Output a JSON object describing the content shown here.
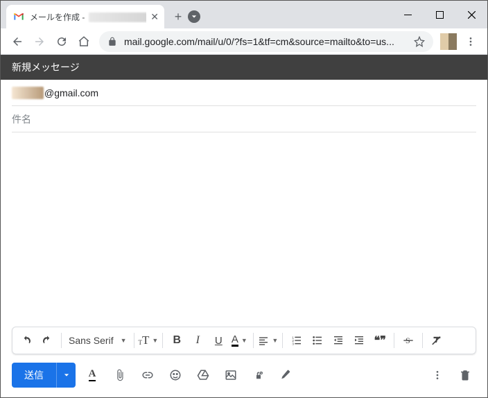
{
  "window": {
    "tab_title_prefix": "メールを作成 - ",
    "new_tab_label": "+"
  },
  "address_bar": {
    "url": "mail.google.com/mail/u/0/?fs=1&tf=cm&source=mailto&to=us..."
  },
  "compose": {
    "header": "新規メッセージ",
    "to_suffix": "@gmail.com",
    "subject_placeholder": "件名",
    "body": ""
  },
  "toolbar": {
    "font_family": "Sans Serif",
    "text_size_label": "T",
    "bold": "B",
    "italic": "I",
    "underline": "U",
    "text_color": "A",
    "quote": "❝❞"
  },
  "send": {
    "label": "送信",
    "text_format": "A"
  }
}
